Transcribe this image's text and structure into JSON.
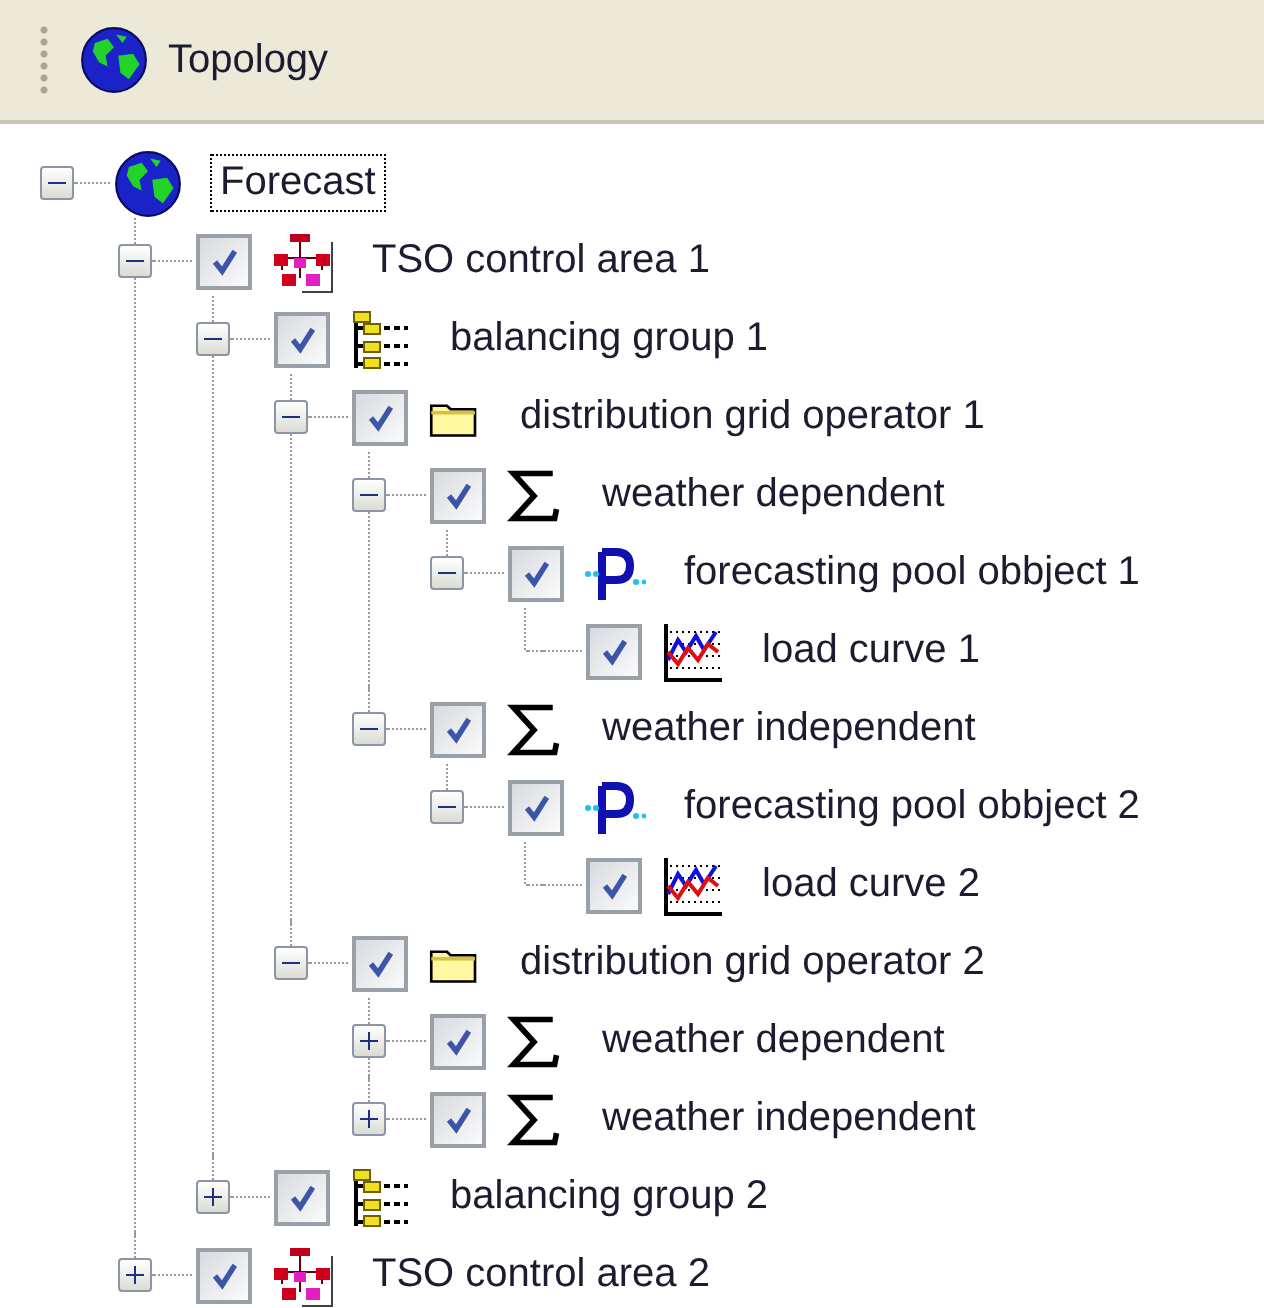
{
  "toolbar": {
    "title": "Topology"
  },
  "tree": [
    {
      "label": "Forecast",
      "kind": "globe",
      "selected": true,
      "expanded": true,
      "children": [
        {
          "label": "TSO control area 1",
          "kind": "network",
          "checked": true,
          "selected": false,
          "expanded": true,
          "children": [
            {
              "label": "balancing group 1",
              "kind": "group",
              "checked": true,
              "selected": false,
              "expanded": true,
              "children": [
                {
                  "label": "distribution grid operator 1",
                  "kind": "folder",
                  "checked": true,
                  "selected": false,
                  "expanded": true,
                  "children": [
                    {
                      "label": "weather dependent",
                      "kind": "sum",
                      "checked": true,
                      "selected": false,
                      "expanded": true,
                      "children": [
                        {
                          "label": "forecasting pool obbject 1",
                          "kind": "pool",
                          "checked": true,
                          "selected": false,
                          "expanded": true,
                          "children": [
                            {
                              "label": "load curve 1",
                              "kind": "curve",
                              "checked": true,
                              "selected": false
                            }
                          ]
                        }
                      ]
                    },
                    {
                      "label": "weather independent",
                      "kind": "sum",
                      "checked": true,
                      "selected": false,
                      "expanded": true,
                      "children": [
                        {
                          "label": "forecasting pool obbject 2",
                          "kind": "pool",
                          "checked": true,
                          "selected": false,
                          "expanded": true,
                          "children": [
                            {
                              "label": "load curve 2",
                              "kind": "curve",
                              "checked": true,
                              "selected": false
                            }
                          ]
                        }
                      ]
                    }
                  ]
                },
                {
                  "label": "distribution grid operator 2",
                  "kind": "folder",
                  "checked": true,
                  "selected": false,
                  "expanded": true,
                  "children": [
                    {
                      "label": "weather dependent",
                      "kind": "sum",
                      "checked": true,
                      "selected": false,
                      "expanded": false
                    },
                    {
                      "label": "weather independent",
                      "kind": "sum",
                      "checked": true,
                      "selected": false,
                      "expanded": false
                    }
                  ]
                }
              ]
            },
            {
              "label": "balancing group 2",
              "kind": "group",
              "checked": true,
              "selected": false,
              "expanded": false
            }
          ]
        },
        {
          "label": "TSO control area 2",
          "kind": "network",
          "checked": true,
          "selected": false,
          "expanded": false
        }
      ]
    }
  ]
}
